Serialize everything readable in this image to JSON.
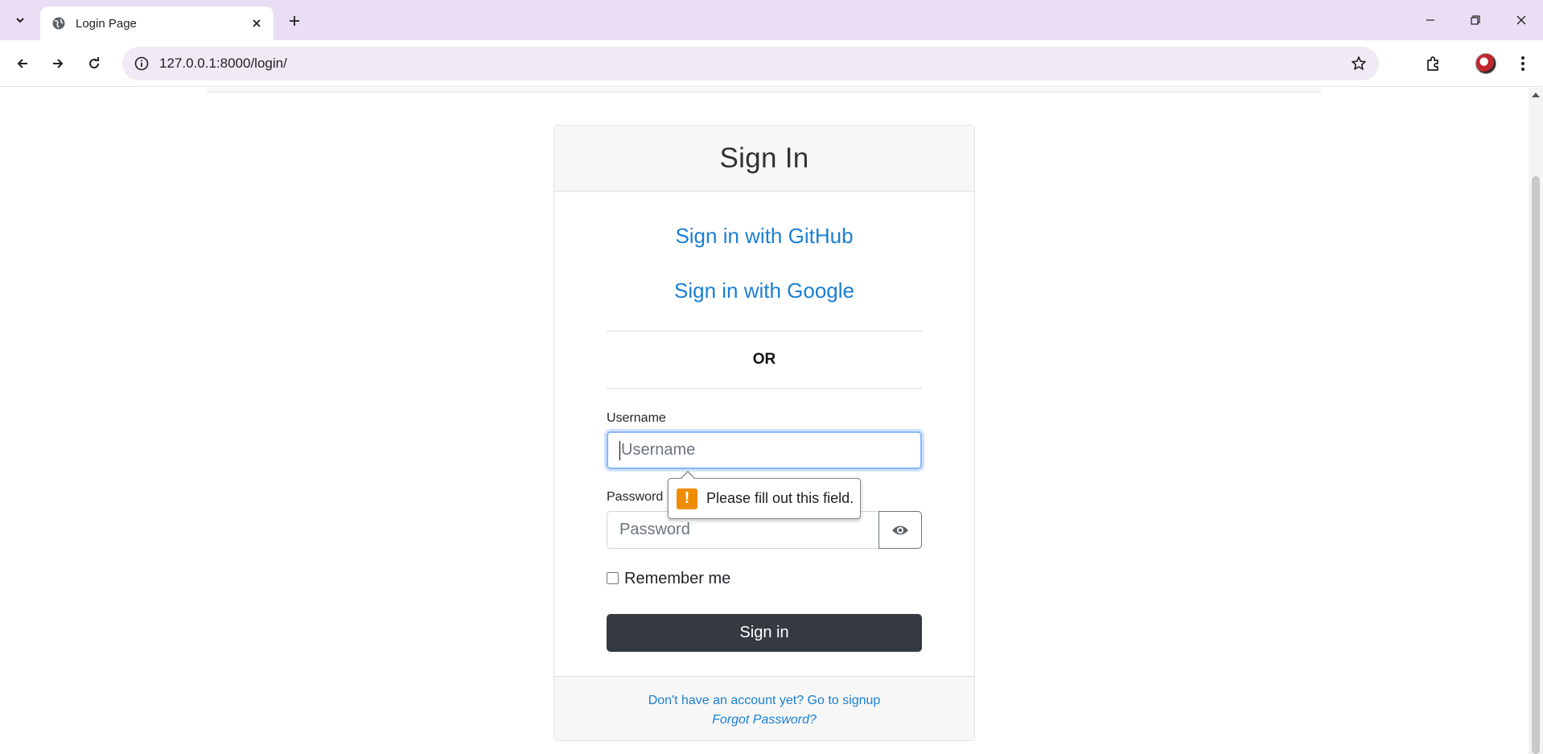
{
  "browser": {
    "tab_title": "Login Page",
    "url": "127.0.0.1:8000/login/"
  },
  "page": {
    "header_title": "Sign In",
    "github_link": "Sign in with GitHub",
    "google_link": "Sign in with Google",
    "or_text": "OR",
    "username_label": "Username",
    "username_placeholder": "Username",
    "password_label": "Password",
    "password_placeholder": "Password",
    "remember_label": "Remember me",
    "remember_checked": false,
    "signin_button": "Sign in",
    "signup_link": "Don't have an account yet? Go to signup",
    "forgot_link": "Forgot Password?"
  },
  "validation": {
    "message": "Please fill out this field.",
    "icon": "warning-icon"
  },
  "colors": {
    "tab_bar": "#e9def3",
    "link": "#1a7fd4",
    "primary_button": "#343a40",
    "warning": "#f08c00"
  }
}
